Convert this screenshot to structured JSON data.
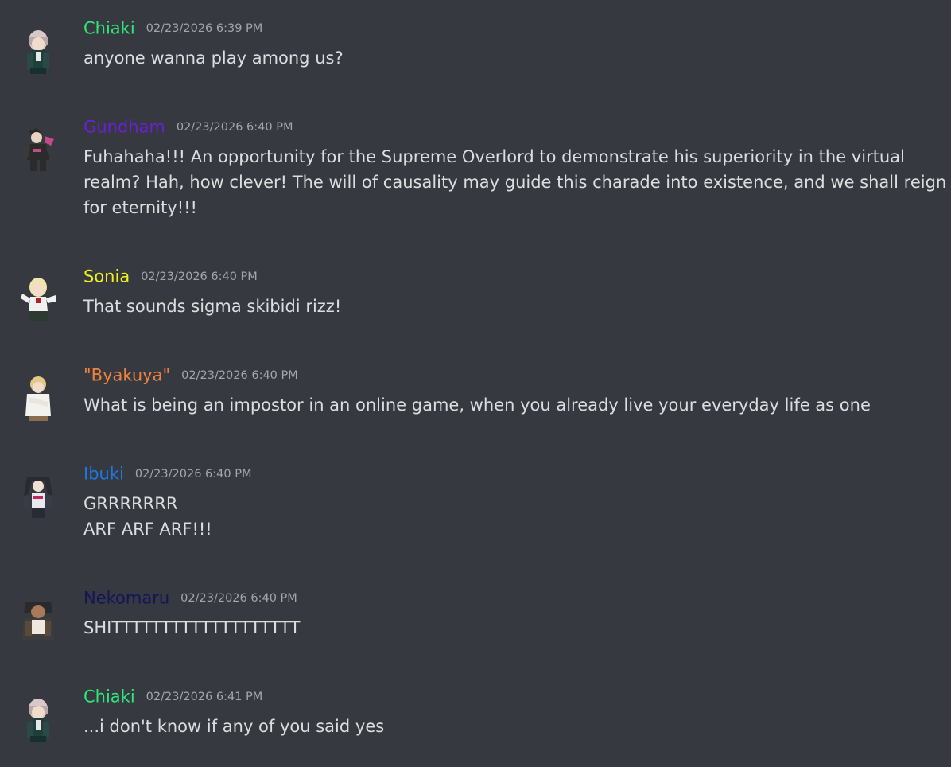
{
  "messages": [
    {
      "username": "Chiaki",
      "username_color": "#2ee67a",
      "timestamp": "02/23/2026 6:39 PM",
      "avatar_icon": "chiaki-avatar-icon",
      "lines": [
        "anyone wanna play among us?"
      ]
    },
    {
      "username": "Gundham",
      "username_color": "#6b1fd6",
      "timestamp": "02/23/2026 6:40 PM",
      "avatar_icon": "gundham-avatar-icon",
      "lines": [
        "Fuhahaha!!! An opportunity for the Supreme Overlord to demonstrate his superiority in the virtual",
        "realm? Hah, how clever! The will of causality may guide this charade into existence, and we shall reign",
        "for eternity!!!"
      ]
    },
    {
      "username": "Sonia",
      "username_color": "#f0f01e",
      "timestamp": "02/23/2026 6:40 PM",
      "avatar_icon": "sonia-avatar-icon",
      "lines": [
        "That sounds sigma skibidi rizz!"
      ]
    },
    {
      "username": "\"Byakuya\"",
      "username_color": "#f0823c",
      "timestamp": "02/23/2026 6:40 PM",
      "avatar_icon": "byakuya-avatar-icon",
      "lines": [
        "What is being an impostor in an online game, when you already live your everyday life as one"
      ]
    },
    {
      "username": "Ibuki",
      "username_color": "#1e78e6",
      "timestamp": "02/23/2026 6:40 PM",
      "avatar_icon": "ibuki-avatar-icon",
      "lines": [
        "GRRRRRRR",
        "ARF ARF ARF!!!"
      ]
    },
    {
      "username": "Nekomaru",
      "username_color": "#14145a",
      "timestamp": "02/23/2026 6:40 PM",
      "avatar_icon": "nekomaru-avatar-icon",
      "lines": [
        "SHITTTTTTTTTTTTTTTTTTT"
      ]
    },
    {
      "username": "Chiaki",
      "username_color": "#2ee67a",
      "timestamp": "02/23/2026 6:41 PM",
      "avatar_icon": "chiaki-avatar-icon",
      "lines": [
        "...i don't know if any of you said yes"
      ]
    }
  ]
}
